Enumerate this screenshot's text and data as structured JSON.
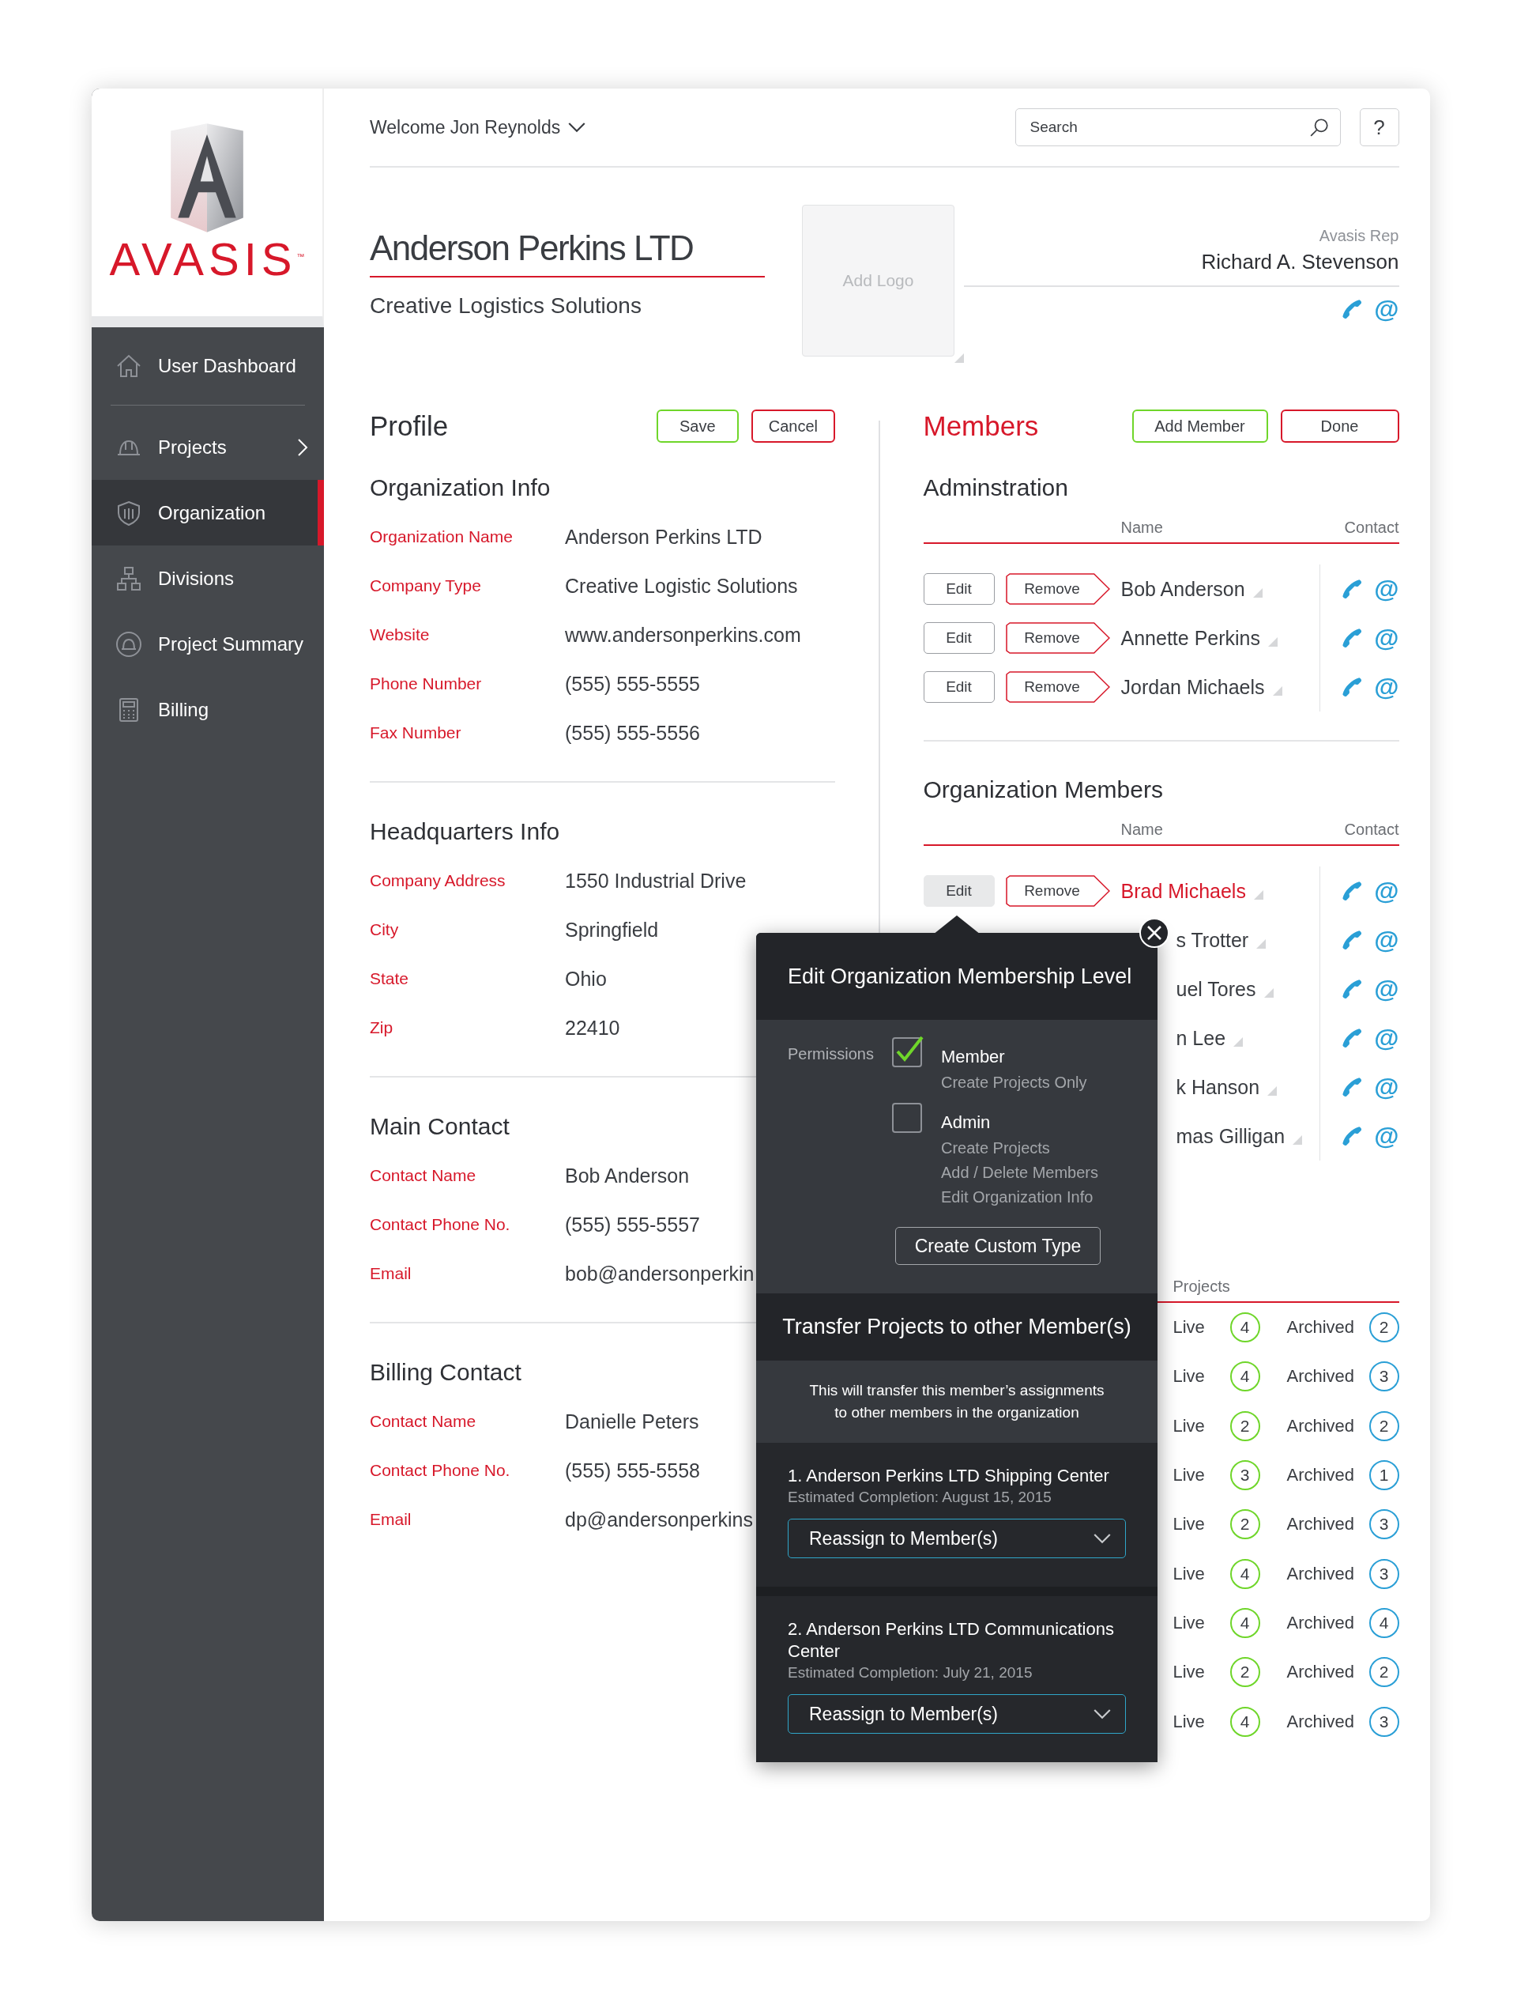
{
  "logo": {
    "wordmark": "AVASIS",
    "tm": "™"
  },
  "sidebar": {
    "items": [
      {
        "label": "User Dashboard",
        "selected": false,
        "has_submenu": false
      },
      {
        "label": "Projects",
        "selected": false,
        "has_submenu": true
      },
      {
        "label": "Organization",
        "selected": true,
        "has_submenu": false
      },
      {
        "label": "Divisions",
        "selected": false,
        "has_submenu": false
      },
      {
        "label": "Project Summary",
        "selected": false,
        "has_submenu": false
      },
      {
        "label": "Billing",
        "selected": false,
        "has_submenu": false
      }
    ]
  },
  "header": {
    "welcome": "Welcome Jon Reynolds",
    "search": {
      "placeholder": "Search"
    },
    "help": "?"
  },
  "company": {
    "name": "Anderson Perkins LTD",
    "tagline": "Creative Logistics Solutions",
    "logo_placeholder": "Add Logo",
    "rep_label": "Avasis Rep",
    "rep_name": "Richard A. Stevenson",
    "email_icon": "@"
  },
  "profile": {
    "title": "Profile",
    "buttons": [
      {
        "label": "Save",
        "kind": "confirm"
      },
      {
        "label": "Cancel",
        "kind": "cancel"
      }
    ],
    "sections": [
      {
        "title": "Organization Info",
        "fields": [
          {
            "label": "Organization Name",
            "value": "Anderson Perkins LTD"
          },
          {
            "label": "Company Type",
            "value": "Creative Logistic Solutions"
          },
          {
            "label": "Website",
            "value": "www.andersonperkins.com"
          },
          {
            "label": "Phone Number",
            "value": "(555) 555-5555"
          },
          {
            "label": "Fax Number",
            "value": "(555) 555-5556"
          }
        ]
      },
      {
        "title": "Headquarters Info",
        "fields": [
          {
            "label": "Company Address",
            "value": "1550 Industrial Drive"
          },
          {
            "label": "City",
            "value": "Springfield"
          },
          {
            "label": "State",
            "value": "Ohio"
          },
          {
            "label": "Zip",
            "value": "22410"
          }
        ]
      },
      {
        "title": "Main Contact",
        "fields": [
          {
            "label": "Contact Name",
            "value": "Bob Anderson"
          },
          {
            "label": "Contact Phone No.",
            "value": "(555) 555-5557"
          },
          {
            "label": "Email",
            "value": "bob@andersonperkin"
          }
        ]
      },
      {
        "title": "Billing Contact",
        "fields": [
          {
            "label": "Contact Name",
            "value": "Danielle Peters"
          },
          {
            "label": "Contact Phone No.",
            "value": "(555) 555-5558"
          },
          {
            "label": "Email",
            "value": "dp@andersonperkins"
          }
        ]
      }
    ]
  },
  "members": {
    "title": "Members",
    "buttons": [
      {
        "label": "Add Member",
        "kind": "confirm"
      },
      {
        "label": "Done",
        "kind": "cancel"
      }
    ],
    "groups": [
      {
        "title": "Adminstration",
        "columns": [
          "Name",
          "Contact"
        ],
        "rows": [
          {
            "kind": "full",
            "edit": "Edit",
            "remove": "Remove",
            "name": "Bob Anderson",
            "selected": false,
            "email_icon": "@"
          },
          {
            "kind": "full",
            "edit": "Edit",
            "remove": "Remove",
            "name": "Annette Perkins",
            "selected": false,
            "email_icon": "@"
          },
          {
            "kind": "full",
            "edit": "Edit",
            "remove": "Remove",
            "name": "Jordan Michaels",
            "selected": false,
            "email_icon": "@"
          }
        ]
      },
      {
        "title": "Organization Members",
        "columns": [
          "Name",
          "Contact"
        ],
        "rows": [
          {
            "kind": "full",
            "edit": "Edit",
            "remove": "Remove",
            "name": "Brad Michaels",
            "selected": true,
            "email_icon": "@"
          },
          {
            "kind": "covered",
            "name": "s Trotter",
            "selected": false,
            "email_icon": "@"
          },
          {
            "kind": "covered",
            "name": "uel Tores",
            "selected": false,
            "email_icon": "@"
          },
          {
            "kind": "covered",
            "name": "n Lee",
            "selected": false,
            "email_icon": "@"
          },
          {
            "kind": "covered",
            "name": "k Hanson",
            "selected": false,
            "email_icon": "@"
          },
          {
            "kind": "covered",
            "name": "mas Gilligan",
            "selected": false,
            "email_icon": "@"
          }
        ]
      }
    ]
  },
  "projects": {
    "column": "Projects",
    "rows": [
      {
        "live_label": "Live",
        "live": "4",
        "archived_label": "Archived",
        "archived": "2"
      },
      {
        "live_label": "Live",
        "live": "4",
        "archived_label": "Archived",
        "archived": "3"
      },
      {
        "live_label": "Live",
        "live": "2",
        "archived_label": "Archived",
        "archived": "2"
      },
      {
        "live_label": "Live",
        "live": "3",
        "archived_label": "Archived",
        "archived": "1"
      },
      {
        "live_label": "Live",
        "live": "2",
        "archived_label": "Archived",
        "archived": "3"
      },
      {
        "live_label": "Live",
        "live": "4",
        "archived_label": "Archived",
        "archived": "3"
      },
      {
        "live_label": "Live",
        "live": "4",
        "archived_label": "Archived",
        "archived": "4"
      },
      {
        "live_label": "Live",
        "live": "2",
        "archived_label": "Archived",
        "archived": "2"
      },
      {
        "live_label": "Live",
        "live": "4",
        "archived_label": "Archived",
        "archived": "3"
      }
    ]
  },
  "popup": {
    "title": "Edit Organization Membership Level",
    "permissions_label": "Permissions",
    "options": [
      {
        "label": "Member",
        "details": [
          "Create Projects Only"
        ],
        "checked": true
      },
      {
        "label": "Admin",
        "details": [
          "Create Projects",
          "Add / Delete Members",
          "Edit Organization Info"
        ],
        "checked": false
      }
    ],
    "custom_button": "Create Custom Type",
    "transfer_title": "Transfer Projects to other Member(s)",
    "transfer_note": [
      "This will transfer this member’s assignments",
      "to other members in the organization"
    ],
    "projects": [
      {
        "title": "1. Anderson Perkins LTD Shipping Center",
        "completion": "Estimated Completion: August 15, 2015",
        "dropdown": "Reassign to Member(s)"
      },
      {
        "title": "2. Anderson Perkins LTD Communications Center",
        "completion": "Estimated Completion: July 21, 2015",
        "dropdown": "Reassign to Member(s)"
      }
    ]
  }
}
